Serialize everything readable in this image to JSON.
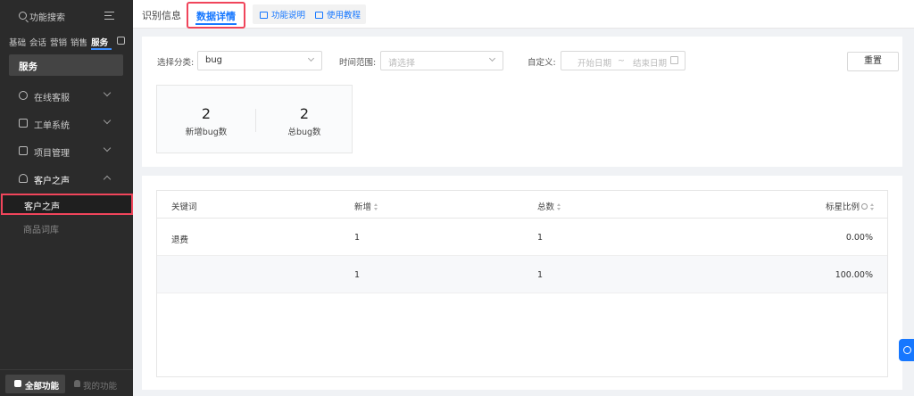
{
  "sidebar": {
    "search_label": "功能搜索",
    "category_tabs": [
      "基础",
      "会话",
      "营销",
      "销售",
      "服务"
    ],
    "active_category": "服务",
    "section_title": "服务",
    "nav": [
      {
        "label": "在线客服"
      },
      {
        "label": "工单系统"
      },
      {
        "label": "项目管理"
      },
      {
        "label": "客户之声"
      }
    ],
    "sub_items": [
      {
        "label": "客户之声"
      },
      {
        "label": "商品词库"
      }
    ],
    "all_functions": "全部功能",
    "my_functions": "我的功能"
  },
  "topbar": {
    "tab_recognition": "识别信息",
    "tab_data_detail": "数据详情",
    "help_func": "功能说明",
    "help_tutorial": "使用教程"
  },
  "filters": {
    "category_label": "选择分类:",
    "category_value": "bug",
    "time_label": "时间范围:",
    "time_placeholder": "请选择",
    "custom_label": "自定义:",
    "start_placeholder": "开始日期",
    "range_sep": "~",
    "end_placeholder": "结束日期",
    "reset_label": "重置"
  },
  "stats": {
    "new_value": "2",
    "new_caption": "新增bug数",
    "total_value": "2",
    "total_caption": "总bug数"
  },
  "table": {
    "headers": [
      "关键词",
      "新增",
      "总数",
      "标星比例"
    ],
    "rows": [
      {
        "keyword": "退费",
        "new": "1",
        "total": "1",
        "star_ratio": "0.00%"
      },
      {
        "keyword": "",
        "new": "1",
        "total": "1",
        "star_ratio": "100.00%"
      }
    ]
  },
  "colors": {
    "accent": "#1677ff",
    "highlight": "#f0455b",
    "sidebar_bg": "#2b2b2b"
  }
}
